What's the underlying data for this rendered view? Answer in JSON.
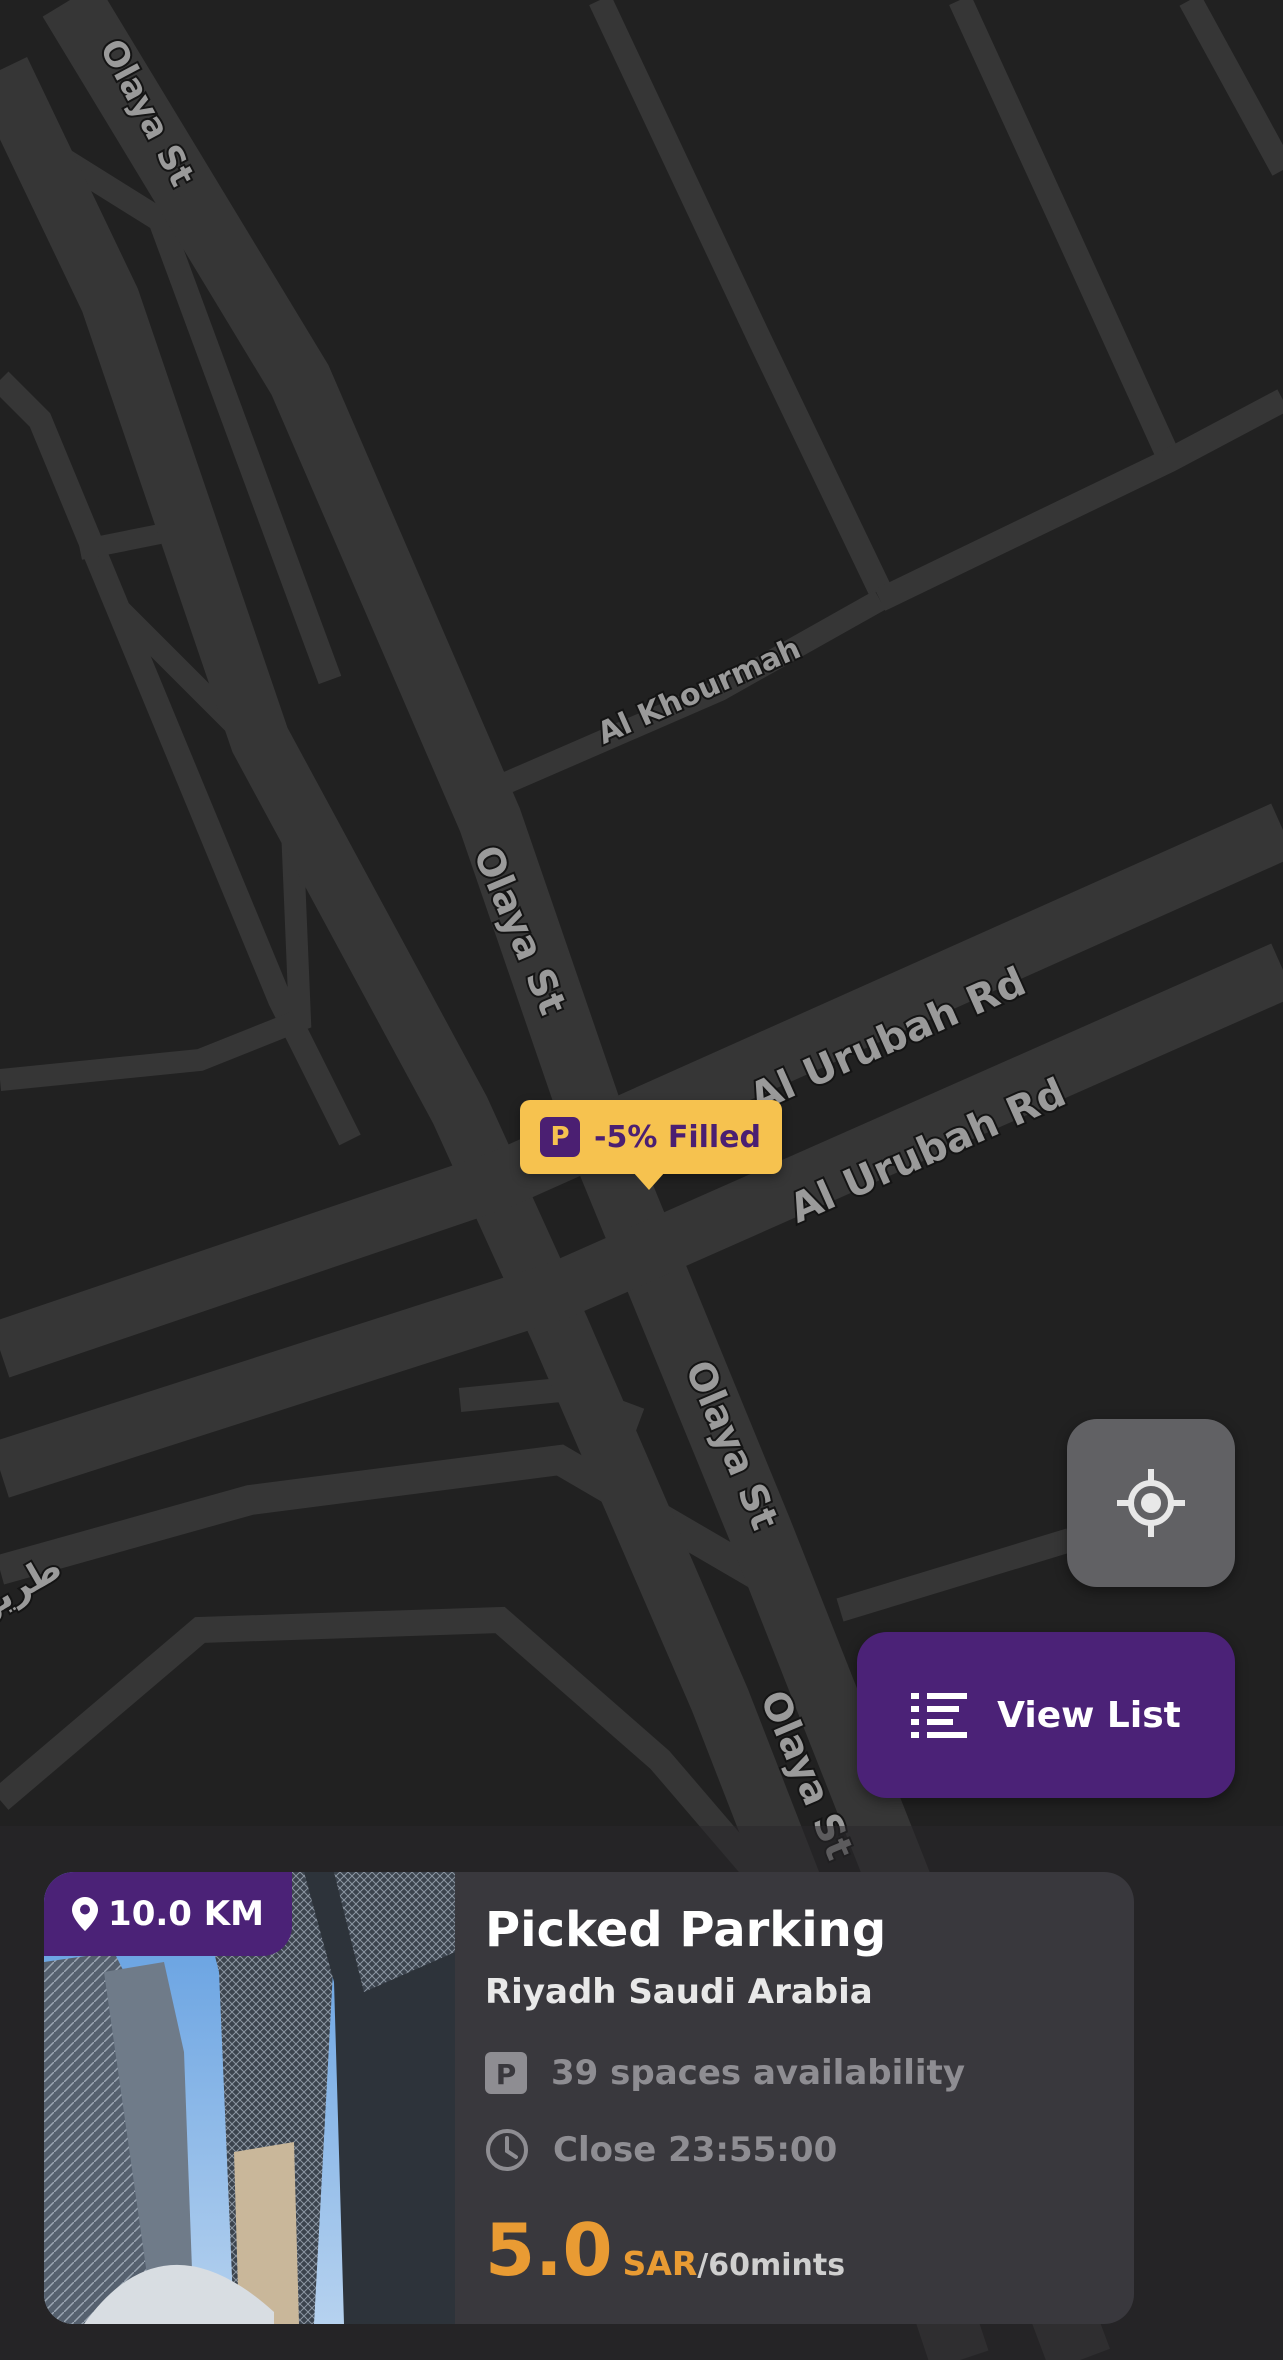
{
  "map": {
    "street_labels": [
      "Olaya St",
      "Al Khourmah",
      "Al Urubah Rd",
      "طريق"
    ]
  },
  "marker": {
    "icon": "parking-icon",
    "label": "-5% Filled"
  },
  "controls": {
    "locate_icon": "crosshair-icon",
    "view_list_icon": "list-icon",
    "view_list_label": "View List"
  },
  "card": {
    "distance": "10.0 KM",
    "distance_icon": "location-pin-icon",
    "title": "Picked Parking",
    "subtitle": "Riyadh Saudi Arabia",
    "spaces_icon": "parking-icon",
    "spaces": "39 spaces availability",
    "close_icon": "clock-icon",
    "close": "Close 23:55:00",
    "price_value": "5.0",
    "price_currency": "SAR",
    "price_unit": "/60mints"
  },
  "colors": {
    "map_bg": "#212121",
    "road": "#3a3a3a",
    "accent_purple": "#4b2277",
    "marker_yellow": "#f6c24f",
    "price_orange": "#e99b33",
    "card_bg": "#39383d"
  }
}
